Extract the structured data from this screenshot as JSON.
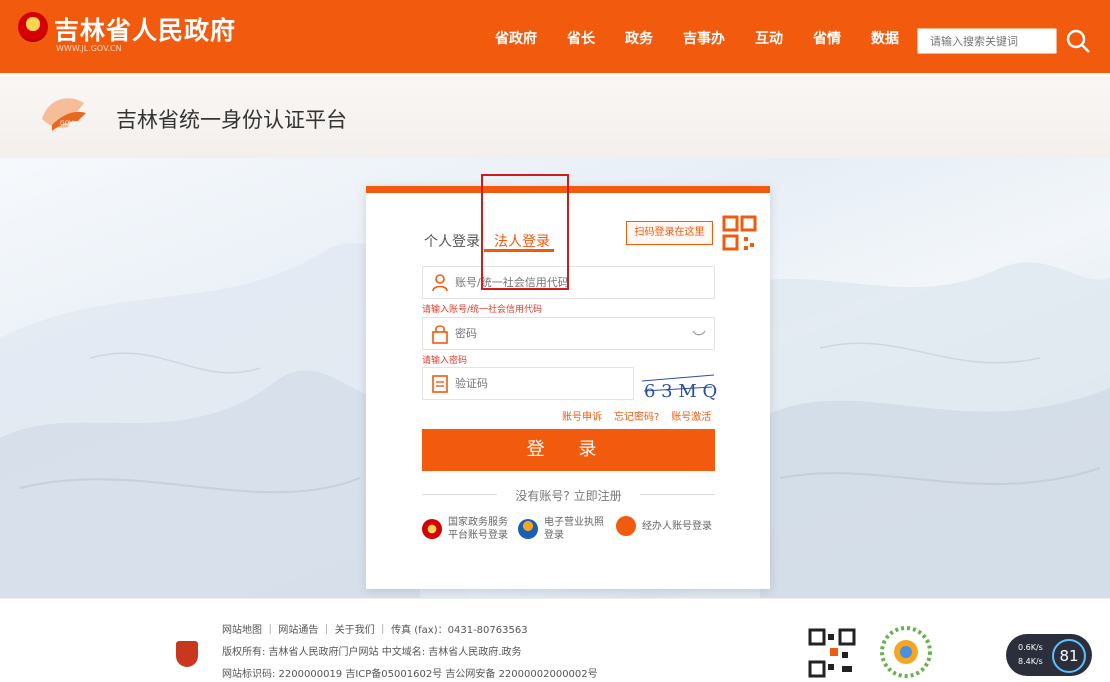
{
  "header": {
    "title": "吉林省人民政府",
    "url": "WWW.JL.GOV.CN",
    "nav": [
      "省政府",
      "省长",
      "政务",
      "吉事办",
      "互动",
      "省情",
      "数据"
    ],
    "search_placeholder": "请输入搜索关键词"
  },
  "subheader": {
    "platform_title": "吉林省统一身份认证平台"
  },
  "login": {
    "tabs": [
      "个人登录",
      "法人登录"
    ],
    "active_tab": "法人登录",
    "qr_tip": "扫码登录在这里",
    "account_placeholder": "账号/统一社会信用代码",
    "account_error": "请输入账号/统一社会信用代码",
    "password_placeholder": "密码",
    "password_error": "请输入密码",
    "captcha_placeholder": "验证码",
    "captcha_text": "6 3 M Q",
    "links": [
      "账号申诉",
      "忘记密码?",
      "账号激活"
    ],
    "submit": "登 录",
    "register": "没有账号? 立即注册",
    "alt_logins": [
      {
        "label": "国家政务服务平台账号登录",
        "icon": "national-emblem-icon"
      },
      {
        "label": "电子营业执照登录",
        "icon": "business-license-icon"
      },
      {
        "label": "经办人账号登录",
        "icon": "agent-person-icon"
      }
    ]
  },
  "footer": {
    "line1": "网站地图 ｜ 网站通告 ｜ 关于我们 ｜ 传真 (fax)：0431-80763563",
    "line2": "版权所有: 吉林省人民政府门户网站 中文域名: 吉林省人民政府.政务",
    "line3": "网站标识码: 2200000019 吉ICP备05001602号 吉公网安备 22000002000002号"
  },
  "speed_widget": {
    "up": "0.6K/s",
    "down": "8.4K/s",
    "value": "81"
  },
  "colors": {
    "brand_orange": "#f25a0d",
    "error_red": "#e03b2c",
    "highlight_red": "#d21a1a"
  }
}
